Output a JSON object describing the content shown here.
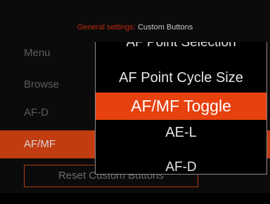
{
  "header": {
    "prefix": "General settings:",
    "title": "Custom Buttons"
  },
  "menu": {
    "items": [
      {
        "label": "Menu"
      },
      {
        "label": "Browse"
      },
      {
        "label": "AF-D"
      },
      {
        "label": "AF/MF"
      }
    ],
    "reset_label": "Reset Custom Buttons"
  },
  "dropdown": {
    "options": [
      "AF Point Selection",
      "AF Point Cycle Size",
      "AF/MF Toggle",
      "AE-L",
      "AF-D"
    ],
    "selected": "AF/MF Toggle"
  },
  "colors": {
    "accent": "#c23c12",
    "highlight": "#e6410f",
    "background": "#0b0b0b"
  }
}
